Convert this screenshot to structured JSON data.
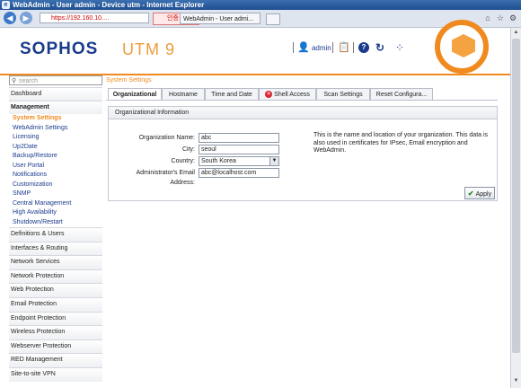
{
  "window": {
    "title": "WebAdmin - User admin - Device utm - Internet Explorer"
  },
  "browser": {
    "url": "https://192.160.10.…",
    "cert_label": "인증…",
    "tab_title": "WebAdmin - User admi...",
    "icons": [
      "back-icon",
      "forward-icon",
      "home-icon",
      "favorites-icon",
      "settings-icon"
    ]
  },
  "header": {
    "logo": "SOPHOS",
    "product": "UTM 9",
    "user": "admin"
  },
  "search": {
    "placeholder": "search"
  },
  "breadcrumb": "System Settings",
  "sidebar": {
    "dashboard": "Dashboard",
    "management": "Management",
    "management_items": [
      "System Settings",
      "WebAdmin Settings",
      "Licensing",
      "Up2Date",
      "Backup/Restore",
      "User Portal",
      "Notifications",
      "Customization",
      "SNMP",
      "Central Management",
      "High Availability",
      "Shutdown/Restart"
    ],
    "sections": [
      "Definitions & Users",
      "Interfaces & Routing",
      "Network Services",
      "Network Protection",
      "Web Protection",
      "Email Protection",
      "Endpoint Protection",
      "Wireless Protection",
      "Webserver Protection",
      "RED Management",
      "Site-to-site VPN"
    ]
  },
  "tabs": [
    "Organizational",
    "Hostname",
    "Time and Date",
    "Shell Access",
    "Scan Settings",
    "Reset Configura..."
  ],
  "panel": {
    "title": "Organizational Information",
    "org_name_label": "Organization Name:",
    "org_name_value": "abc",
    "city_label": "City:",
    "city_value": "seoul",
    "country_label": "Country:",
    "country_value": "South Korea",
    "email_label": "Administrator's Email Address:",
    "email_value": "abc@localhost.com",
    "help": "This is the name and location of your organization. This data is also used in certificates for IPsec, Email encryption and WebAdmin.",
    "apply": "Apply"
  }
}
